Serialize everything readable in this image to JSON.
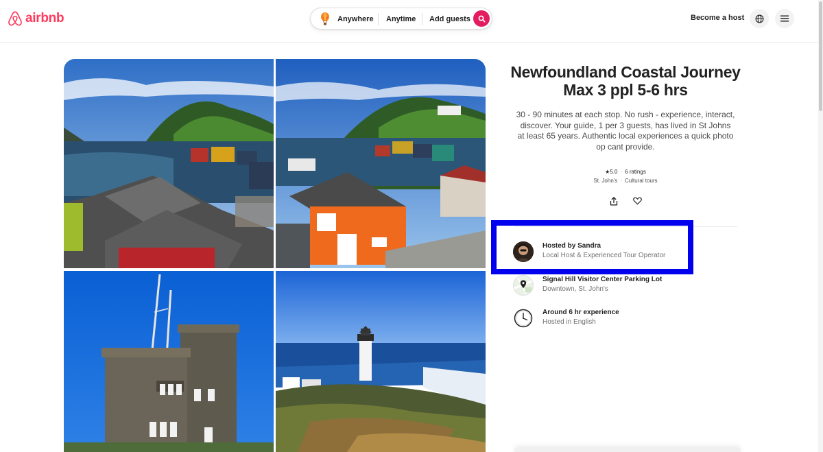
{
  "brand": {
    "name": "airbnb",
    "color": "#ff385c"
  },
  "header": {
    "search": {
      "where": "Anywhere",
      "when": "Anytime",
      "who": "Add guests"
    },
    "become_host": "Become a host",
    "icons": {
      "globe": "globe-icon",
      "menu": "hamburger-menu-icon",
      "search": "search-icon"
    }
  },
  "listing": {
    "title_line1": "Newfoundland Coastal Journey",
    "title_line2": "Max 3 ppl 5-6 hrs",
    "description": "30 - 90 minutes at each stop. No rush - experience, interact, discover. Your guide, 1 per 3 guests, has lived in St Johns at least 65 years. Authentic local experiences a quick photo op cant provide.",
    "rating": "★5.0",
    "ratings_count": "6 ratings",
    "city": "St. John's",
    "category": "Cultural tours",
    "photos": [
      "harbour-houses-photo",
      "orange-shed-harbour-photo",
      "cabot-tower-photo",
      "cape-spear-lighthouse-photo"
    ]
  },
  "details": {
    "host": {
      "title": "Hosted by Sandra",
      "subtitle": "Local Host & Experienced Tour Operator"
    },
    "meeting": {
      "title": "Signal Hill Visitor Center Parking Lot",
      "subtitle": "Downtown, St. John's"
    },
    "duration": {
      "title": "Around 6 hr experience",
      "subtitle": "Hosted in English"
    }
  },
  "colors": {
    "accent": "#e31c5f",
    "highlight": "#0000ee"
  }
}
